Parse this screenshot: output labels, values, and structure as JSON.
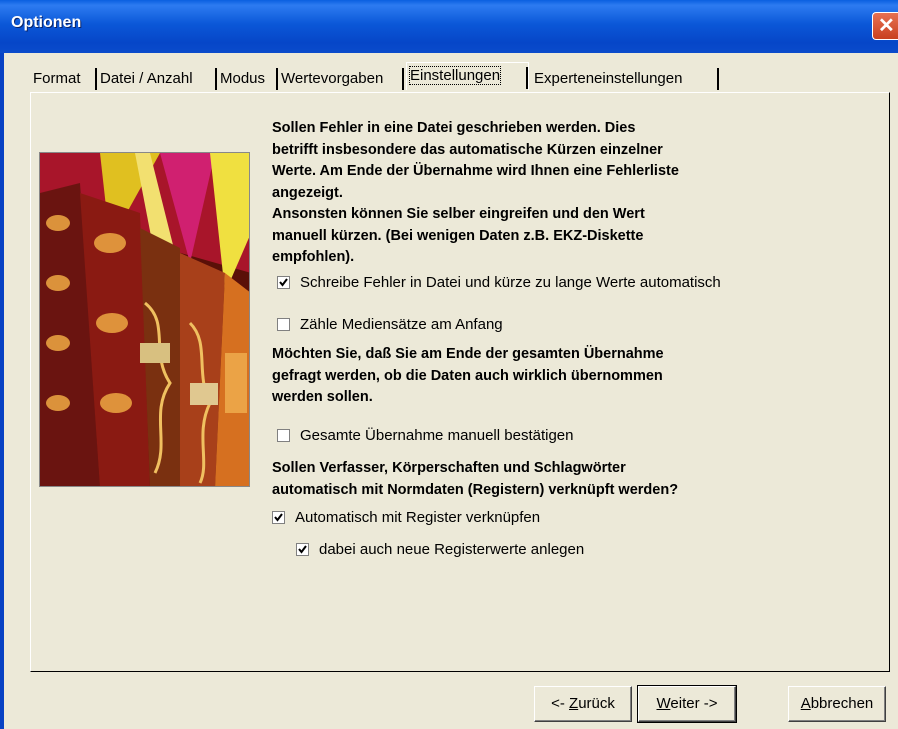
{
  "window": {
    "title": "Optionen"
  },
  "tabs": [
    {
      "label": "Format"
    },
    {
      "label": "Datei / Anzahl"
    },
    {
      "label": "Modus"
    },
    {
      "label": "Wertevorgaben"
    },
    {
      "label": "Einstellungen",
      "active": true
    },
    {
      "label": "Experteneinstellungen"
    }
  ],
  "section1": {
    "lines": [
      "Sollen Fehler in eine Datei geschrieben werden. Dies",
      "betrifft insbesondere das automatische Kürzen einzelner",
      "Werte. Am Ende der Übernahme wird Ihnen eine Fehlerliste",
      "angezeigt.",
      "Ansonsten können Sie selber eingreifen und den Wert",
      "manuell kürzen. (Bei wenigen Daten z.B. EKZ-Diskette",
      "empfohlen)."
    ]
  },
  "checkboxes": {
    "write_errors": {
      "label": "Schreibe Fehler in Datei und kürze zu lange Werte automatisch",
      "checked": true
    },
    "count_records": {
      "label": "Zähle Mediensätze am Anfang",
      "checked": false
    },
    "confirm_manual": {
      "label": "Gesamte Übernahme manuell bestätigen",
      "checked": false
    },
    "link_register": {
      "label": "Automatisch mit Register verknüpfen",
      "checked": true
    },
    "new_register_values": {
      "label": "dabei auch neue Registerwerte anlegen",
      "checked": true
    }
  },
  "section2": {
    "lines": [
      "Möchten Sie, daß Sie am Ende der gesamten Übernahme",
      "gefragt werden, ob die Daten auch wirklich übernommen",
      "werden sollen."
    ]
  },
  "section3": {
    "lines": [
      "Sollen Verfasser, Körperschaften und Schlagwörter",
      "automatisch mit Normdaten (Registern) verknüpft werden?"
    ]
  },
  "buttons": {
    "back": {
      "prefix": "<- ",
      "accel": "Z",
      "rest": "urück"
    },
    "next": {
      "accel": "W",
      "rest": "eiter ->"
    },
    "cancel": {
      "accel": "A",
      "rest": "bbrechen"
    }
  },
  "icons": {
    "close": "close-icon",
    "checkmark": "checkmark-icon",
    "illustration": "old-books-illustration"
  }
}
